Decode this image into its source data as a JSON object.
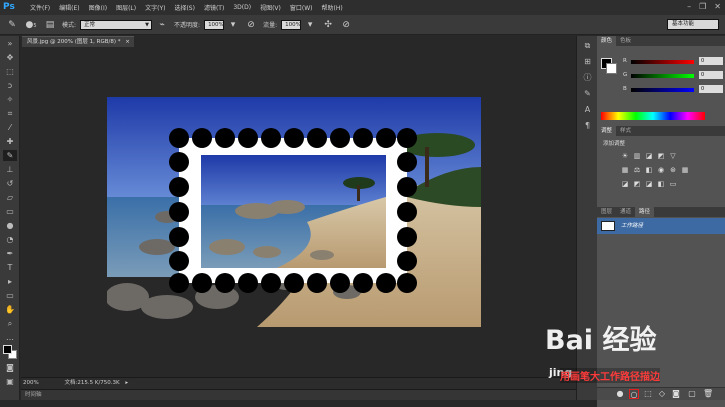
{
  "app": {
    "logo": "Ps"
  },
  "menu": [
    "文件(F)",
    "编辑(E)",
    "图像(I)",
    "图层(L)",
    "文字(Y)",
    "选择(S)",
    "滤镜(T)",
    "3D(D)",
    "视图(V)",
    "窗口(W)",
    "帮助(H)"
  ],
  "window_controls": {
    "minimize": "–",
    "restore": "❐",
    "close": "✕"
  },
  "options": {
    "mode_label": "模式:",
    "mode_value": "正常",
    "opacity_label": "不透明度:",
    "opacity_value": "100%",
    "flow_label": "流量:",
    "flow_value": "100%",
    "brush_size": "5",
    "workspace": "基本功能"
  },
  "document": {
    "tab_title": "风景.jpg @ 200% (图层 1, RGB/8) *",
    "close_glyph": "×"
  },
  "status": {
    "zoom": "200%",
    "doc_info": "文档:215.5 K/750.3K",
    "timeline": "时间轴"
  },
  "panels": {
    "color_tabs": [
      "颜色",
      "色板"
    ],
    "channels": [
      {
        "label": "R",
        "value": "0",
        "gradient": "linear-gradient(to right,#000,#f00)"
      },
      {
        "label": "G",
        "value": "0",
        "gradient": "linear-gradient(to right,#000,#0f0)"
      },
      {
        "label": "B",
        "value": "0",
        "gradient": "linear-gradient(to right,#000,#00f)"
      }
    ],
    "adjust_tabs": [
      "调整",
      "样式"
    ],
    "adjust_title": "添加调整",
    "layers_tabs": [
      "图层",
      "通道",
      "路径"
    ],
    "path_item": "工作路径"
  },
  "colors": {
    "accent_blue": "#3d6aa3",
    "caption_red": "#ff3b3b"
  },
  "watermark": {
    "logo": "Bai 经验",
    "sub": "jing",
    "caption": "用画笔大工作路径描边"
  }
}
